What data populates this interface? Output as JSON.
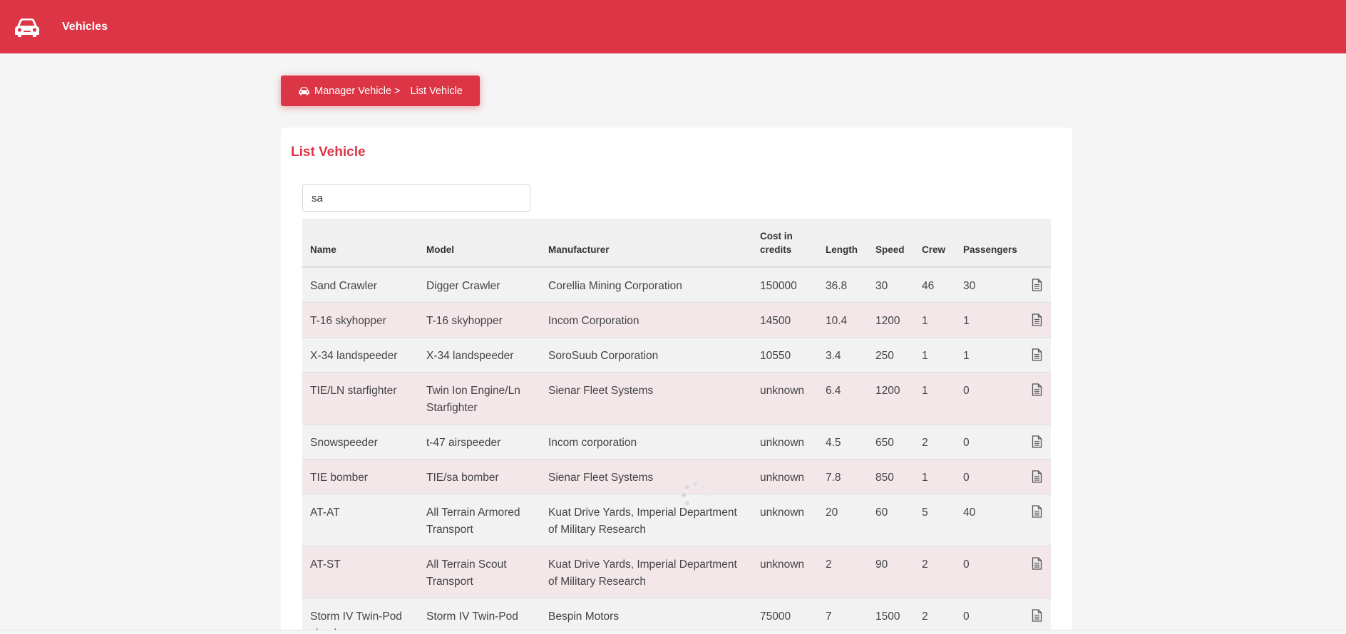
{
  "header": {
    "title": "Vehicles",
    "logo_icon": "car-icon",
    "color": "#dc3545"
  },
  "breadcrumb": {
    "icon": "car-icon",
    "parent": "Manager Vehicle >",
    "current": "List Vehicle"
  },
  "card": {
    "title": "List Vehicle"
  },
  "search": {
    "value": "sa",
    "placeholder": ""
  },
  "table": {
    "columns": [
      "Name",
      "Model",
      "Manufacturer",
      "Cost in credits",
      "Length",
      "Speed",
      "Crew",
      "Passengers"
    ],
    "rows": [
      {
        "name": "Sand Crawler",
        "model": "Digger Crawler",
        "manufacturer": "Corellia Mining Corporation",
        "cost": "150000",
        "length": "36.8",
        "speed": "30",
        "crew": "46",
        "passengers": "30"
      },
      {
        "name": "T-16 skyhopper",
        "model": "T-16 skyhopper",
        "manufacturer": "Incom Corporation",
        "cost": "14500",
        "length": "10.4",
        "speed": "1200",
        "crew": "1",
        "passengers": "1"
      },
      {
        "name": "X-34 landspeeder",
        "model": "X-34 landspeeder",
        "manufacturer": "SoroSuub Corporation",
        "cost": "10550",
        "length": "3.4",
        "speed": "250",
        "crew": "1",
        "passengers": "1"
      },
      {
        "name": "TIE/LN starfighter",
        "model": "Twin Ion Engine/Ln Starfighter",
        "manufacturer": "Sienar Fleet Systems",
        "cost": "unknown",
        "length": "6.4",
        "speed": "1200",
        "crew": "1",
        "passengers": "0"
      },
      {
        "name": "Snowspeeder",
        "model": "t-47 airspeeder",
        "manufacturer": "Incom corporation",
        "cost": "unknown",
        "length": "4.5",
        "speed": "650",
        "crew": "2",
        "passengers": "0"
      },
      {
        "name": "TIE bomber",
        "model": "TIE/sa bomber",
        "manufacturer": "Sienar Fleet Systems",
        "cost": "unknown",
        "length": "7.8",
        "speed": "850",
        "crew": "1",
        "passengers": "0"
      },
      {
        "name": "AT-AT",
        "model": "All Terrain Armored Transport",
        "manufacturer": "Kuat Drive Yards, Imperial Department of Military Research",
        "cost": "unknown",
        "length": "20",
        "speed": "60",
        "crew": "5",
        "passengers": "40"
      },
      {
        "name": "AT-ST",
        "model": "All Terrain Scout Transport",
        "manufacturer": "Kuat Drive Yards, Imperial Department of Military Research",
        "cost": "unknown",
        "length": "2",
        "speed": "90",
        "crew": "2",
        "passengers": "0"
      },
      {
        "name": "Storm IV Twin-Pod cloud car",
        "model": "Storm IV Twin-Pod",
        "manufacturer": "Bespin Motors",
        "cost": "75000",
        "length": "7",
        "speed": "1500",
        "crew": "2",
        "passengers": "0"
      }
    ],
    "row_action_icon": "document-icon"
  },
  "loading_icon": "spinner-icon"
}
